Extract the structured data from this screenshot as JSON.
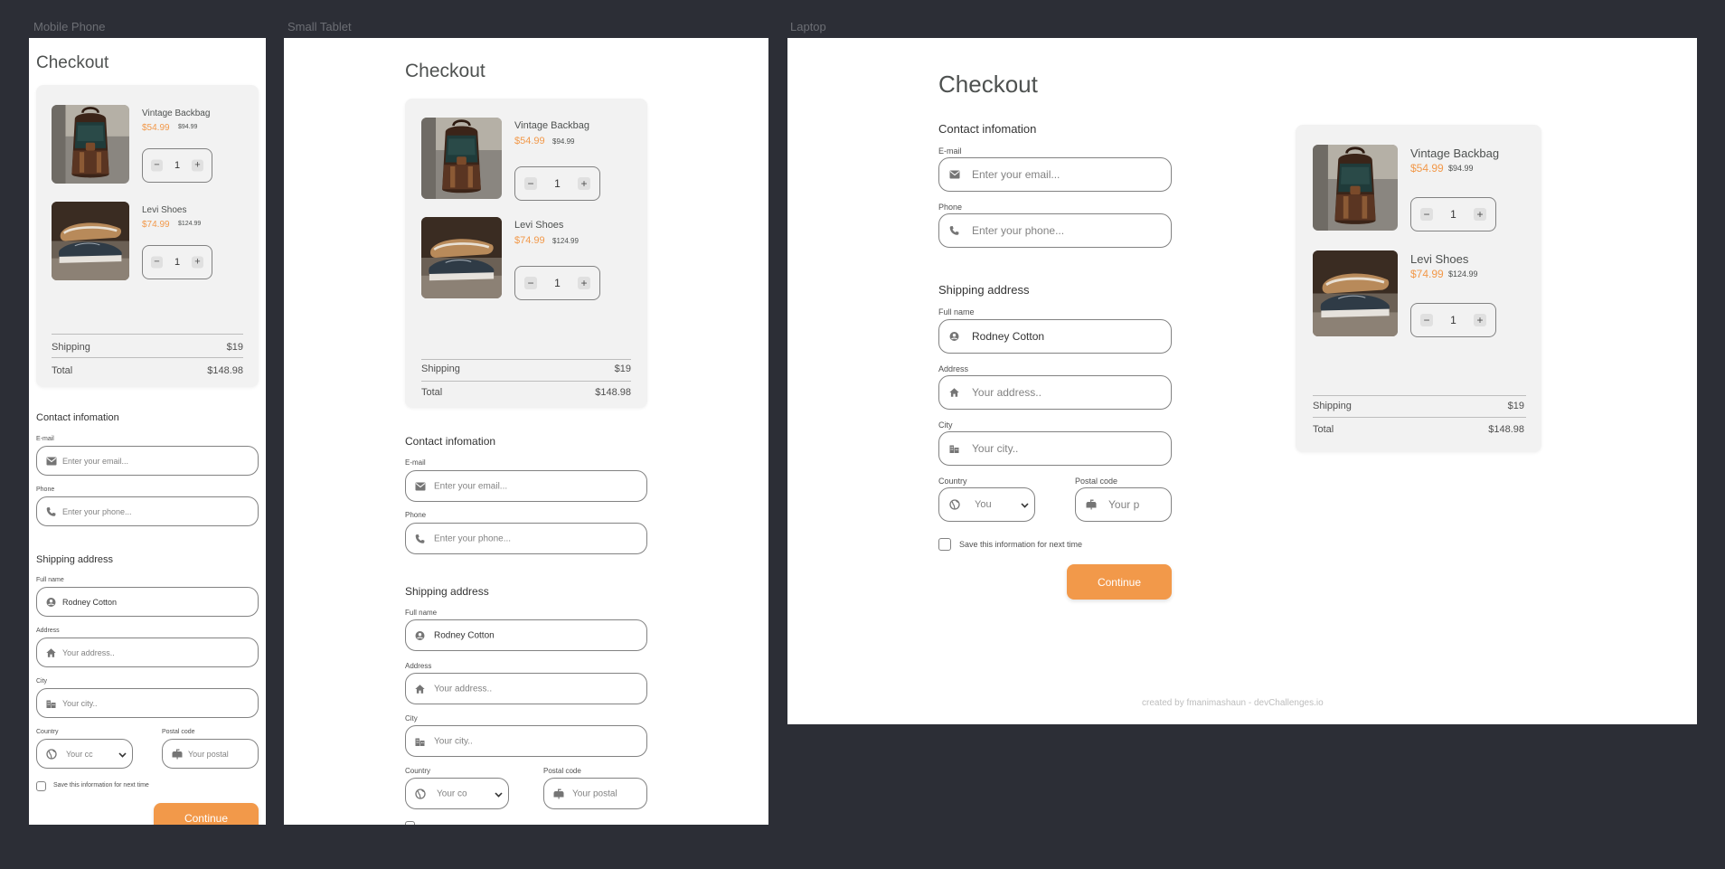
{
  "frames": {
    "mobile": "Mobile Phone",
    "tablet": "Small Tablet",
    "laptop": "Laptop"
  },
  "checkout": {
    "title": "Checkout",
    "contact_title": "Contact infomation",
    "shipping_title": "Shipping address",
    "save_label": "Save this information for next time",
    "continue_label": "Continue"
  },
  "fields": {
    "email": {
      "label": "E-mail",
      "placeholder": "Enter your email...",
      "icon": "mail-icon"
    },
    "phone": {
      "label": "Phone",
      "placeholder": "Enter your phone...",
      "icon": "phone-icon"
    },
    "fullname": {
      "label": "Full name",
      "value": "Rodney Cotton",
      "icon": "user-icon"
    },
    "address": {
      "label": "Address",
      "placeholder": "Your address..",
      "icon": "home-icon"
    },
    "city": {
      "label": "City",
      "placeholder": "Your city..",
      "icon": "city-icon"
    },
    "country": {
      "label": "Country",
      "icon": "globe-icon",
      "shown_mobile": "Your cc",
      "shown_tablet": "Your co",
      "shown_laptop": "You"
    },
    "postal": {
      "label": "Postal code",
      "icon": "mailbox-icon",
      "shown_mobile": "Your postal",
      "shown_tablet": "Your postal",
      "shown_laptop": "Your p"
    }
  },
  "cart": {
    "items": [
      {
        "name": "Vintage Backbag",
        "price": "$54.99",
        "old_price": "$94.99",
        "qty": "1"
      },
      {
        "name": "Levi Shoes",
        "price": "$74.99",
        "old_price": "$124.99",
        "qty": "1"
      }
    ],
    "shipping_label": "Shipping",
    "shipping_value": "$19",
    "total_label": "Total",
    "total_value": "$148.98"
  },
  "steppers": {
    "minus": "−",
    "plus": "+"
  },
  "footer": {
    "credit": "created by fmanimashaun - devChallenges.io"
  },
  "colors": {
    "accent": "#f2994a",
    "background": "#2c2e36",
    "card": "#f2f2f2",
    "text": "#4e5150"
  }
}
